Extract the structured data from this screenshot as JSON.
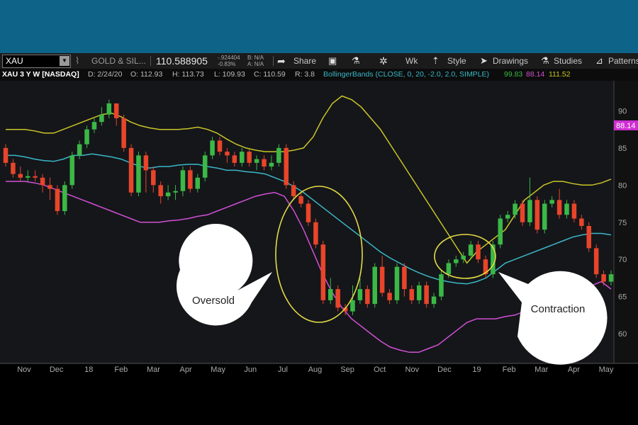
{
  "toolbar": {
    "symbol": "XAU",
    "description": "GOLD & SIL...",
    "last_price": "110.588905",
    "change": "-.924404",
    "change_pct": "-0.83%",
    "bid": "B: N/A",
    "ask": "A: N/A",
    "share_label": "Share",
    "interval_label": "Wk",
    "style_label": "Style",
    "drawings_label": "Drawings",
    "studies_label": "Studies",
    "patterns_label": "Patterns"
  },
  "infobar": {
    "title": "XAU 3 Y W [NASDAQ]",
    "date": "D: 2/24/20",
    "open": "O: 112.93",
    "high": "H: 113.73",
    "low": "L: 109.93",
    "close": "C: 110.59",
    "range": "R: 3.8",
    "study": "BollingerBands (CLOSE, 0, 20, -2.0, 2.0, SIMPLE)",
    "lower_val": "99.83",
    "mid_val": "88.14",
    "upper_val": "111.52"
  },
  "colors": {
    "background": "#15161a",
    "up": "#3bb847",
    "down": "#e8452a",
    "upper_band": "#c9c527",
    "middle_band": "#3ab8c6",
    "lower_band": "#d050d4",
    "price_tag": "#cf2fd2",
    "ellipse": "#e4dc45",
    "topband": "#0e6388"
  },
  "chart_data": {
    "type": "candlestick",
    "y_ticks": [
      60,
      65,
      70,
      75,
      80,
      85,
      90
    ],
    "ylim": [
      56,
      93
    ],
    "x_labels": [
      "Nov",
      "Dec",
      "18",
      "Feb",
      "Mar",
      "Apr",
      "May",
      "Jun",
      "Jul",
      "Aug",
      "Sep",
      "Oct",
      "Nov",
      "Dec",
      "19",
      "Feb",
      "Mar",
      "Apr",
      "May"
    ],
    "price_tag": "88.14",
    "upper_band": [
      87.5,
      87.5,
      87.5,
      87.3,
      87.0,
      87.0,
      87.5,
      88.0,
      88.5,
      89.0,
      89.5,
      89.7,
      89.2,
      88.5,
      88.0,
      87.7,
      87.5,
      87.5,
      87.5,
      87.6,
      87.8,
      87.5,
      87.0,
      86.2,
      85.5,
      85.0,
      84.7,
      84.5,
      84.5,
      84.5,
      84.7,
      85.0,
      86.5,
      89.0,
      91.0,
      92.0,
      91.5,
      90.5,
      89.0,
      87.5,
      85.5,
      83.5,
      81.5,
      79.5,
      77.5,
      75.5,
      73.5,
      71.5,
      69.5,
      71.0,
      72.0,
      73.0,
      74.0,
      76.0,
      78.0,
      79.0,
      80.0,
      80.5,
      80.5,
      80.2,
      80.0,
      80.0,
      80.3,
      80.8
    ],
    "middle_band": [
      84.0,
      84.0,
      83.8,
      83.5,
      83.3,
      83.2,
      83.5,
      84.0,
      84.0,
      84.2,
      84.0,
      83.8,
      83.5,
      83.0,
      82.5,
      82.3,
      82.5,
      82.5,
      82.7,
      82.8,
      82.8,
      82.5,
      82.3,
      82.0,
      82.0,
      81.8,
      81.7,
      81.5,
      81.0,
      80.5,
      79.8,
      79.0,
      78.0,
      77.0,
      76.0,
      75.0,
      74.0,
      73.0,
      72.0,
      71.0,
      70.2,
      69.5,
      68.8,
      68.2,
      67.7,
      67.3,
      67.0,
      66.8,
      66.7,
      67.0,
      67.5,
      68.5,
      69.5,
      70.0,
      70.5,
      71.0,
      71.5,
      72.0,
      72.5,
      73.0,
      73.3,
      73.5,
      73.5,
      73.3
    ],
    "lower_band": [
      80.5,
      80.5,
      80.5,
      80.3,
      80.0,
      79.5,
      79.0,
      78.5,
      78.0,
      77.5,
      77.0,
      76.5,
      76.0,
      75.5,
      75.0,
      75.0,
      75.0,
      75.2,
      75.3,
      75.5,
      75.8,
      76.0,
      76.5,
      77.0,
      77.5,
      78.0,
      78.5,
      78.8,
      79.0,
      78.5,
      76.5,
      74.0,
      71.0,
      68.0,
      65.5,
      63.5,
      62.0,
      61.0,
      60.0,
      59.0,
      58.2,
      57.8,
      57.5,
      57.5,
      58.0,
      58.5,
      59.5,
      60.5,
      61.5,
      62.0,
      62.0,
      62.0,
      62.3,
      62.5,
      63.0,
      63.3,
      63.8,
      64.5,
      65.0,
      65.5,
      66.0,
      66.5,
      67.0,
      66.0
    ],
    "candles": [
      [
        85.0,
        83.0,
        85.5,
        82.5
      ],
      [
        83.0,
        81.5,
        83.5,
        81.0
      ],
      [
        81.5,
        81.0,
        82.5,
        80.5
      ],
      [
        81.0,
        81.2,
        82.0,
        80.5
      ],
      [
        81.2,
        81.0,
        82.0,
        80.5
      ],
      [
        81.0,
        80.0,
        81.5,
        79.0
      ],
      [
        80.0,
        79.5,
        81.0,
        78.0
      ],
      [
        79.5,
        76.5,
        80.0,
        76.0
      ],
      [
        76.5,
        80.0,
        80.5,
        76.0
      ],
      [
        80.0,
        84.0,
        84.5,
        79.5
      ],
      [
        84.0,
        85.5,
        86.0,
        83.5
      ],
      [
        85.5,
        87.5,
        88.0,
        85.0
      ],
      [
        87.5,
        88.5,
        89.0,
        87.0
      ],
      [
        88.5,
        89.5,
        90.5,
        88.0
      ],
      [
        89.5,
        91.0,
        91.5,
        89.0
      ],
      [
        91.0,
        89.0,
        91.0,
        88.0
      ],
      [
        89.0,
        85.0,
        89.5,
        84.5
      ],
      [
        85.0,
        79.0,
        85.5,
        78.5
      ],
      [
        79.0,
        84.0,
        84.5,
        78.5
      ],
      [
        84.0,
        82.0,
        84.5,
        79.0
      ],
      [
        82.0,
        80.0,
        82.5,
        79.0
      ],
      [
        80.0,
        78.5,
        80.5,
        77.5
      ],
      [
        78.5,
        79.0,
        80.0,
        78.0
      ],
      [
        79.0,
        79.2,
        80.0,
        78.0
      ],
      [
        79.2,
        82.0,
        82.5,
        78.5
      ],
      [
        82.0,
        79.5,
        82.5,
        79.0
      ],
      [
        79.5,
        81.0,
        81.5,
        79.0
      ],
      [
        81.0,
        84.0,
        84.5,
        80.5
      ],
      [
        84.0,
        86.0,
        86.5,
        83.5
      ],
      [
        86.0,
        84.5,
        86.5,
        84.0
      ],
      [
        84.5,
        84.0,
        85.0,
        83.0
      ],
      [
        84.0,
        83.0,
        84.5,
        82.5
      ],
      [
        83.0,
        84.5,
        85.0,
        82.5
      ],
      [
        84.5,
        83.0,
        84.8,
        82.5
      ],
      [
        83.0,
        83.5,
        84.0,
        82.0
      ],
      [
        83.5,
        82.5,
        84.0,
        82.0
      ],
      [
        82.5,
        83.0,
        84.0,
        82.0
      ],
      [
        83.0,
        85.0,
        85.5,
        82.5
      ],
      [
        85.0,
        80.0,
        85.5,
        79.5
      ],
      [
        80.0,
        78.5,
        80.5,
        78.0
      ],
      [
        78.5,
        77.5,
        79.0,
        77.0
      ],
      [
        77.5,
        75.0,
        78.0,
        74.5
      ],
      [
        75.0,
        72.0,
        75.5,
        71.5
      ],
      [
        72.0,
        64.5,
        72.5,
        64.0
      ],
      [
        64.5,
        66.0,
        67.5,
        64.0
      ],
      [
        66.0,
        63.5,
        66.5,
        63.0
      ],
      [
        63.5,
        63.0,
        64.0,
        62.5
      ],
      [
        63.0,
        64.5,
        66.5,
        62.5
      ],
      [
        64.5,
        66.0,
        67.5,
        64.0
      ],
      [
        66.0,
        64.0,
        66.5,
        63.5
      ],
      [
        64.0,
        69.0,
        69.5,
        63.5
      ],
      [
        69.0,
        65.5,
        70.5,
        65.0
      ],
      [
        65.5,
        64.5,
        66.0,
        64.0
      ],
      [
        64.5,
        69.0,
        69.5,
        64.0
      ],
      [
        69.0,
        66.0,
        69.5,
        65.0
      ],
      [
        66.0,
        64.5,
        66.5,
        64.0
      ],
      [
        64.5,
        66.5,
        67.0,
        64.0
      ],
      [
        66.5,
        64.0,
        67.0,
        63.5
      ],
      [
        64.0,
        65.0,
        65.5,
        63.5
      ],
      [
        65.0,
        68.0,
        68.5,
        64.5
      ],
      [
        68.0,
        69.5,
        70.0,
        67.5
      ],
      [
        69.5,
        70.0,
        70.5,
        69.0
      ],
      [
        70.0,
        70.5,
        71.0,
        69.5
      ],
      [
        70.5,
        72.0,
        72.5,
        70.0
      ],
      [
        72.0,
        70.0,
        72.5,
        69.5
      ],
      [
        70.0,
        68.0,
        70.5,
        67.5
      ],
      [
        68.0,
        72.0,
        72.5,
        67.5
      ],
      [
        72.0,
        75.5,
        76.0,
        71.5
      ],
      [
        75.5,
        76.0,
        76.5,
        75.0
      ],
      [
        76.0,
        77.5,
        78.0,
        75.5
      ],
      [
        77.5,
        75.0,
        78.0,
        74.5
      ],
      [
        75.0,
        78.0,
        81.0,
        74.5
      ],
      [
        78.0,
        74.0,
        78.5,
        73.5
      ],
      [
        74.0,
        77.5,
        78.0,
        73.5
      ],
      [
        77.5,
        78.0,
        78.5,
        77.0
      ],
      [
        78.0,
        76.0,
        79.5,
        75.5
      ],
      [
        76.0,
        77.5,
        78.0,
        75.5
      ],
      [
        77.5,
        75.5,
        78.0,
        75.0
      ],
      [
        75.5,
        74.5,
        76.0,
        74.0
      ],
      [
        74.5,
        71.5,
        75.0,
        71.0
      ],
      [
        71.5,
        68.0,
        72.0,
        67.5
      ],
      [
        68.0,
        67.0,
        68.5,
        66.5
      ],
      [
        67.0,
        68.0,
        68.5,
        66.5
      ]
    ],
    "annotations": [
      "Oversold",
      "Contraction"
    ]
  }
}
